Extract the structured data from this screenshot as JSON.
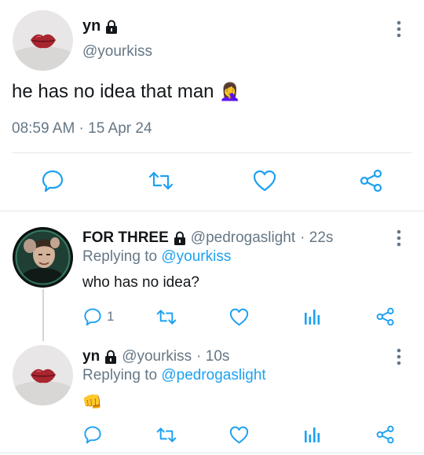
{
  "main_tweet": {
    "name": "yn",
    "handle": "@yourkiss",
    "text": "he has no idea that man",
    "emoji": "🤦‍♀️",
    "timestamp": "08:59 AM · 15 Apr 24"
  },
  "replies": [
    {
      "name": "FOR THREE",
      "handle": "@pedrogaslight",
      "age": "· 22s",
      "replying_label": "Replying to",
      "replying_to": "@yourkiss",
      "text": "who has no idea?",
      "reply_count": "1"
    },
    {
      "name": "yn",
      "handle": "@yourkiss",
      "age": "· 10s",
      "replying_label": "Replying to",
      "replying_to": "@pedrogaslight",
      "text": "👊"
    }
  ],
  "colors": {
    "text": "#14171a",
    "secondary": "#657786",
    "link": "#1da1f2",
    "divider": "#e1e8ed"
  }
}
